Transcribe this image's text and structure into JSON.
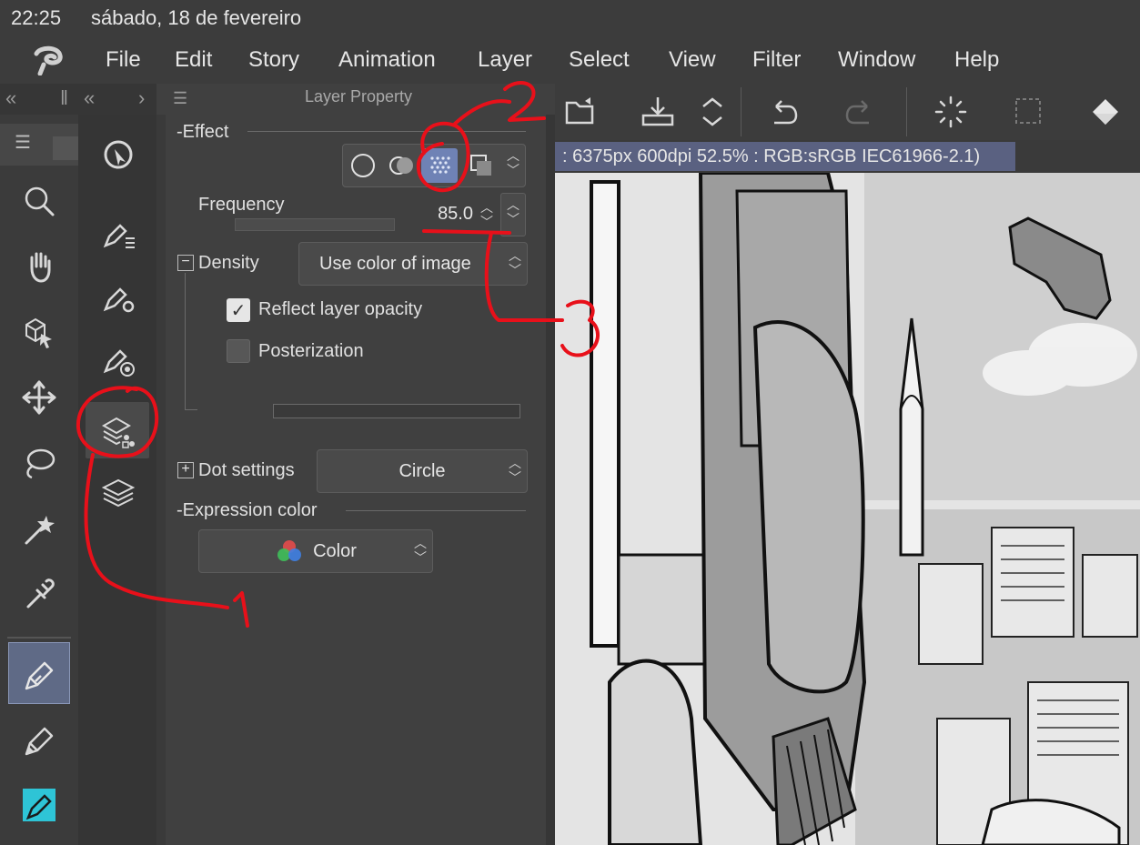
{
  "status": {
    "time": "22:25",
    "date": "sábado, 18 de fevereiro"
  },
  "menu": [
    "File",
    "Edit",
    "Story",
    "Animation",
    "Layer",
    "Select",
    "View",
    "Filter",
    "Window",
    "Help"
  ],
  "panel": {
    "title": "Layer Property",
    "effect": {
      "label": "Effect",
      "options": [
        "border-circle-icon",
        "color-blend-icon",
        "tone-dots-icon",
        "layer-copy-icon"
      ],
      "selected": "tone-dots-icon"
    },
    "frequency": {
      "label": "Frequency",
      "value": "85.0"
    },
    "density": {
      "label": "Density",
      "value": "Use color of image"
    },
    "reflect_opacity": {
      "label": "Reflect layer opacity",
      "checked": true
    },
    "posterization": {
      "label": "Posterization",
      "checked": false
    },
    "dot_settings": {
      "label": "Dot settings",
      "value": "Circle"
    },
    "expression_color": {
      "label": "Expression color",
      "value": "Color"
    }
  },
  "canvas": {
    "info": ": 6375px 600dpi 52.5% : RGB:sRGB IEC61966-2.1)"
  },
  "annotations": [
    "1",
    "2",
    "3"
  ],
  "colors": {
    "accent": "#6f82b5",
    "active_tool": "#5f6a86",
    "annotation": "#e8101a",
    "info_bar": "#5a6181",
    "teal_tool": "#2ec4d6"
  },
  "icons": {
    "tools": [
      "zoom-icon",
      "hand-icon",
      "object-select-icon",
      "move-icon",
      "lasso-icon",
      "magic-wand-icon",
      "eyedropper-icon",
      "pen-icon",
      "pencil-icon",
      "brush-icon"
    ],
    "sub_tools": [
      "navigator-icon",
      "tool-property-icon",
      "sub-tool-detail-icon",
      "brush-size-icon",
      "layer-property-icon",
      "layers-icon"
    ],
    "toolbar": [
      "open-file-icon",
      "save-icon",
      "more-icon",
      "undo-icon",
      "redo-icon",
      "loading-icon",
      "selection-icon",
      "fill-icon"
    ]
  }
}
